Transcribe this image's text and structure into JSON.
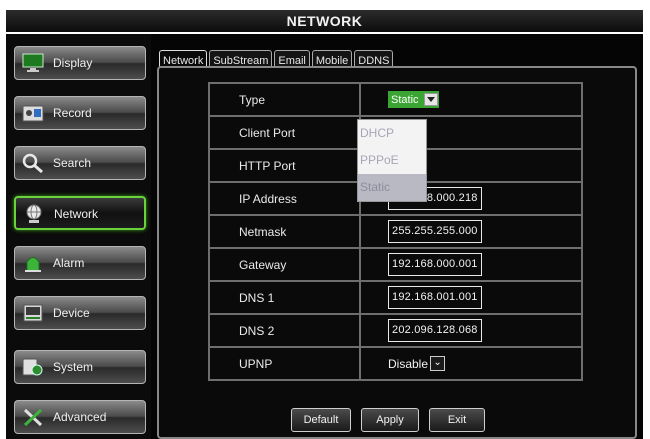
{
  "window": {
    "title": "NETWORK"
  },
  "sidebar": {
    "items": [
      {
        "label": "Display",
        "icon": "monitor-icon"
      },
      {
        "label": "Record",
        "icon": "record-camera-icon"
      },
      {
        "label": "Search",
        "icon": "magnifier-icon"
      },
      {
        "label": "Network",
        "icon": "globe-network-icon",
        "active": true
      },
      {
        "label": "Alarm",
        "icon": "alarm-siren-icon"
      },
      {
        "label": "Device",
        "icon": "device-disk-icon"
      },
      {
        "label": "System",
        "icon": "system-settings-icon"
      },
      {
        "label": "Advanced",
        "icon": "tools-icon"
      }
    ]
  },
  "tabs": [
    "Network",
    "SubStream",
    "Email",
    "Mobile",
    "DDNS"
  ],
  "form": {
    "type_label": "Type",
    "type_value": "Static",
    "type_options": [
      "DHCP",
      "PPPoE",
      "Static"
    ],
    "client_port_label": "Client Port",
    "http_port_label": "HTTP Port",
    "ip_label": "IP Address",
    "ip_value": "192.168.000.218",
    "netmask_label": "Netmask",
    "netmask_value": "255.255.255.000",
    "gateway_label": "Gateway",
    "gateway_value": "192.168.000.001",
    "dns1_label": "DNS 1",
    "dns1_value": "192.168.001.001",
    "dns2_label": "DNS 2",
    "dns2_value": "202.096.128.068",
    "upnp_label": "UPNP",
    "upnp_value": "Disable"
  },
  "buttons": {
    "default": "Default",
    "apply": "Apply",
    "exit": "Exit"
  },
  "colors": {
    "active_border": "#6ad33b",
    "select_bg": "#3aa532",
    "panel_bg": "#0a0a0a"
  }
}
